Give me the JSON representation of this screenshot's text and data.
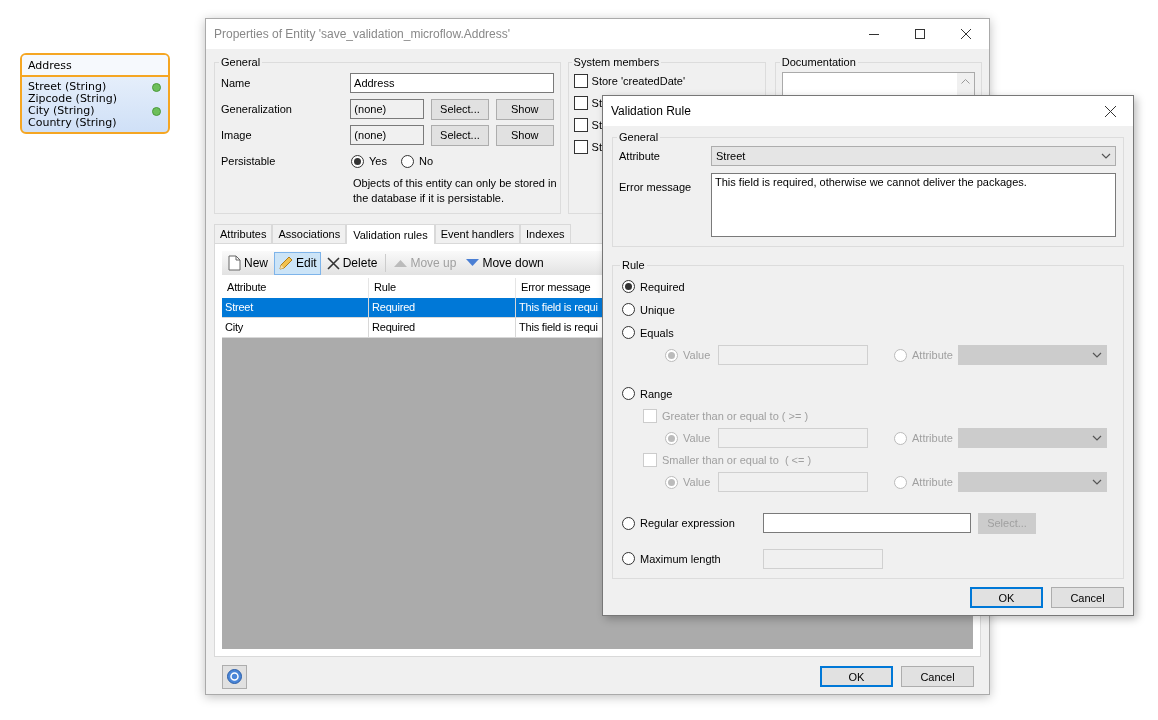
{
  "canvas": {
    "entity": {
      "name": "Address",
      "attributes": [
        {
          "label": "Street (String)",
          "has_rule": true
        },
        {
          "label": "Zipcode (String)",
          "has_rule": false
        },
        {
          "label": "City (String)",
          "has_rule": true
        },
        {
          "label": "Country (String)",
          "has_rule": false
        }
      ]
    }
  },
  "properties_window": {
    "title": "Properties of Entity 'save_validation_microflow.Address'",
    "general": {
      "legend": "General",
      "rows": [
        {
          "kind": "text",
          "label": "Name",
          "value": "Address"
        },
        {
          "kind": "reference",
          "label": "Generalization",
          "value": "(none)",
          "buttons": [
            "Select...",
            "Show"
          ]
        },
        {
          "kind": "reference",
          "label": "Image",
          "value": "(none)",
          "buttons": [
            "Select...",
            "Show"
          ]
        },
        {
          "kind": "choice",
          "label": "Persistable",
          "options": [
            {
              "label": "Yes",
              "selected": true
            },
            {
              "label": "No",
              "selected": false
            }
          ]
        }
      ],
      "note": "Objects of this entity can only be stored in the database if it is persistable."
    },
    "system_members": {
      "legend": "System members",
      "items": [
        {
          "label": "Store 'createdDate'",
          "checked": false
        },
        {
          "label": "St",
          "checked": false
        },
        {
          "label": "St",
          "checked": false
        },
        {
          "label": "St",
          "checked": false
        }
      ]
    },
    "documentation": {
      "legend": "Documentation"
    },
    "tabs": [
      {
        "label": "Attributes",
        "selected": false
      },
      {
        "label": "Associations",
        "selected": false
      },
      {
        "label": "Validation rules",
        "selected": true
      },
      {
        "label": "Event handlers",
        "selected": false
      },
      {
        "label": "Indexes",
        "selected": false
      }
    ],
    "toolbar": [
      {
        "kind": "new",
        "label": "New",
        "pressed": false,
        "disabled": false
      },
      {
        "kind": "edit",
        "label": "Edit",
        "pressed": true,
        "disabled": false
      },
      {
        "kind": "delete",
        "label": "Delete",
        "pressed": false,
        "disabled": false
      },
      {
        "kind": "move_up",
        "label": "Move up",
        "pressed": false,
        "disabled": true
      },
      {
        "kind": "move_down",
        "label": "Move down",
        "pressed": false,
        "disabled": false
      }
    ],
    "grid": {
      "columns": [
        "Attribute",
        "Rule",
        "Error message"
      ],
      "rows": [
        {
          "cells": [
            "Street",
            "Required",
            "This field is requi"
          ],
          "selected": true
        },
        {
          "cells": [
            "City",
            "Required",
            "This field is requi"
          ],
          "selected": false
        }
      ]
    },
    "buttons": [
      {
        "label": "OK",
        "default": true
      },
      {
        "label": "Cancel",
        "default": false
      }
    ]
  },
  "validation_dialog": {
    "title": "Validation Rule",
    "general": {
      "legend": "General",
      "attribute_label": "Attribute",
      "attribute_value": "Street",
      "error_label": "Error message",
      "error_value": "This field is required, otherwise we cannot deliver the packages."
    },
    "rule": {
      "legend": "Rule",
      "options": [
        {
          "kind": "plain",
          "label": "Required",
          "selected": true
        },
        {
          "kind": "plain",
          "label": "Unique",
          "selected": false
        },
        {
          "kind": "equals",
          "label": "Equals",
          "selected": false,
          "operand": {
            "disabled": true,
            "value_label": "Value",
            "value_selected": true,
            "attribute_label": "Attribute",
            "attribute_selected": false
          }
        },
        {
          "kind": "range",
          "label": "Range",
          "selected": false,
          "bounds": [
            {
              "label": "Greater than or equal to ( >= )",
              "checked": false,
              "disabled": true,
              "operand": {
                "disabled": true,
                "value_label": "Value",
                "value_selected": true,
                "attribute_label": "Attribute",
                "attribute_selected": false
              }
            },
            {
              "label": "Smaller than or equal to  ( <= )",
              "checked": false,
              "disabled": true,
              "operand": {
                "disabled": true,
                "value_label": "Value",
                "value_selected": true,
                "attribute_label": "Attribute",
                "attribute_selected": false
              }
            }
          ]
        },
        {
          "kind": "regex",
          "label": "Regular expression",
          "selected": false,
          "button": {
            "label": "Select...",
            "disabled": true
          }
        },
        {
          "kind": "max_length",
          "label": "Maximum length",
          "selected": false
        }
      ]
    },
    "buttons": [
      {
        "label": "OK",
        "default": true
      },
      {
        "label": "Cancel",
        "default": false
      }
    ]
  }
}
